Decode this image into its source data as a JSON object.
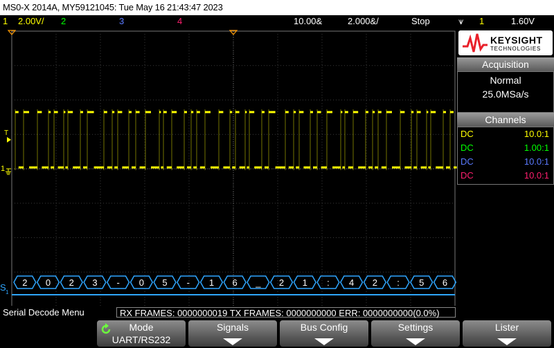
{
  "title": "MS0-X 2014A, MY59121045: Tue May 16 21:43:47 2023",
  "status": {
    "ch1_num": "1",
    "ch1_scale": "2.00V/",
    "ch2_num": "2",
    "ch3_num": "3",
    "ch4_num": "4",
    "timebase_pos": "10.00&",
    "timebase_scale": "2.000&/",
    "run_state": "Stop",
    "trigger_icon": "⩛",
    "trig_ch": "1",
    "trig_level": "1.60V"
  },
  "markers": {
    "trigger_label": "T",
    "ch1_label": "1",
    "serial_label": "S",
    "serial_sub": "1"
  },
  "decode_symbols": [
    "2",
    "0",
    "2",
    "3",
    "-",
    "0",
    "5",
    "-",
    "1",
    "6",
    "_",
    "2",
    "1",
    ":",
    "4",
    "2",
    ":",
    "5",
    "6"
  ],
  "logo": {
    "brand": "KEYSIGHT",
    "sub": "TECHNOLOGIES"
  },
  "acquisition": {
    "header": "Acquisition",
    "mode": "Normal",
    "rate": "25.0MSa/s"
  },
  "channels": {
    "header": "Channels",
    "rows": [
      {
        "coupling": "DC",
        "value": "10.0:1",
        "color": "#ffff00"
      },
      {
        "coupling": "DC",
        "value": "1.00:1",
        "color": "#00ff00"
      },
      {
        "coupling": "DC",
        "value": "10.0:1",
        "color": "#5a7aff"
      },
      {
        "coupling": "DC",
        "value": "10.0:1",
        "color": "#ff1e6e"
      }
    ]
  },
  "decode": {
    "menu_name": "Serial Decode Menu",
    "frames": "RX FRAMES: 0000000019  TX FRAMES: 0000000000  ERR: 0000000000(0.0%)"
  },
  "softkeys": [
    {
      "label": "Mode",
      "sub": "UART/RS232",
      "has_arrow": false,
      "icon": "refresh-icon"
    },
    {
      "label": "Signals",
      "sub": "",
      "has_arrow": true
    },
    {
      "label": "Bus Config",
      "sub": "",
      "has_arrow": true
    },
    {
      "label": "Settings",
      "sub": "",
      "has_arrow": true
    },
    {
      "label": "Lister",
      "sub": "",
      "has_arrow": true
    }
  ],
  "colors": {
    "ch1": "#ffff00",
    "ch2": "#00ff00",
    "ch3": "#5a7aff",
    "ch4": "#ff1e6e",
    "serial": "#2fa6ff",
    "trigger": "#ff9a00"
  }
}
